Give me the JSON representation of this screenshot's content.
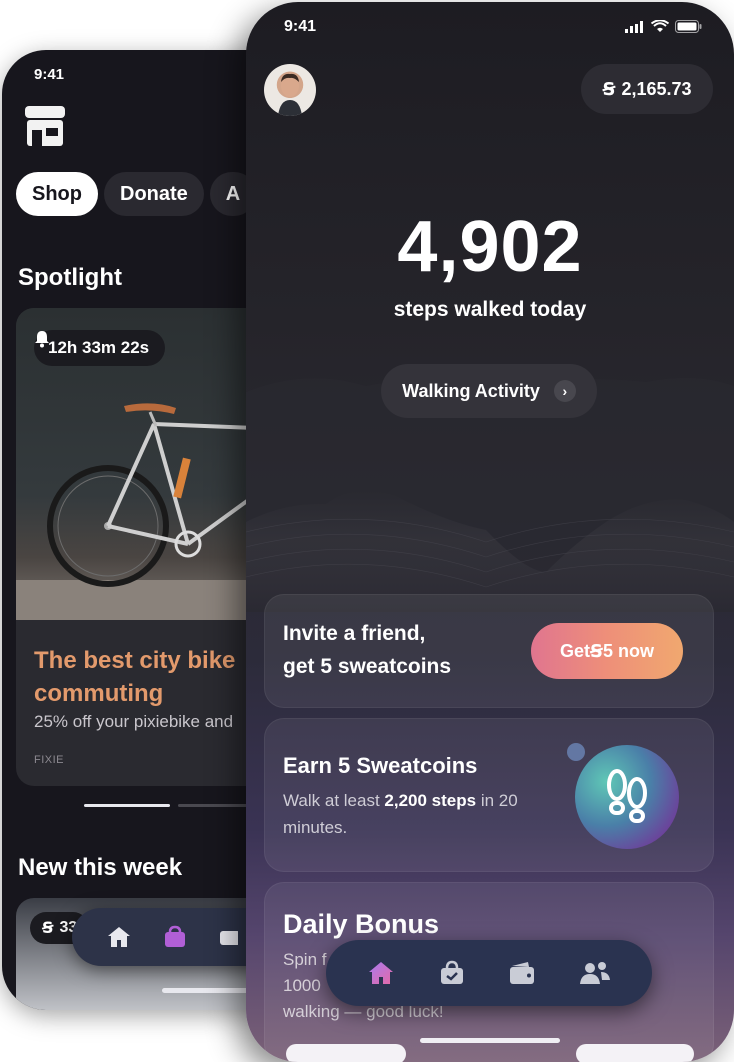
{
  "back_phone": {
    "status_time": "9:41",
    "tabs": [
      {
        "label": "Shop",
        "active": true
      },
      {
        "label": "Donate",
        "active": false
      },
      {
        "label": "A",
        "active": false
      }
    ],
    "spotlight_heading": "Spotlight",
    "spotlight_card": {
      "timer": "12h 33m 22s",
      "title_line1": "The best city bike",
      "title_line2": "commuting",
      "subtitle": "25% off your pixiebike and",
      "brand": "FIXIE"
    },
    "new_heading": "New this week",
    "new_card_badge": "33",
    "nav_items": [
      "home-icon",
      "shop-icon",
      "wallet-icon"
    ]
  },
  "front_phone": {
    "status_time": "9:41",
    "balance": "2,165.73",
    "steps_count": "4,902",
    "steps_label": "steps walked today",
    "walking_button": "Walking Activity",
    "invite_card": {
      "line1": "Invite a friend,",
      "line2": "get 5 sweatcoins",
      "button_prefix": "Get ",
      "button_amount": "5 now"
    },
    "earn_card": {
      "title": "Earn 5 Sweatcoins",
      "sub_prefix": "Walk at least ",
      "sub_bold": "2,200 steps",
      "sub_suffix": "in 20 minutes."
    },
    "daily_card": {
      "title": "Daily Bonus",
      "line1": "Spin f",
      "line1_end": "o",
      "line2": "1000",
      "line3": "walking — good luck!"
    },
    "nav_items": [
      "home-icon",
      "shop-icon",
      "wallet-icon",
      "friends-icon"
    ],
    "accent_color": "#8e6bd8"
  }
}
